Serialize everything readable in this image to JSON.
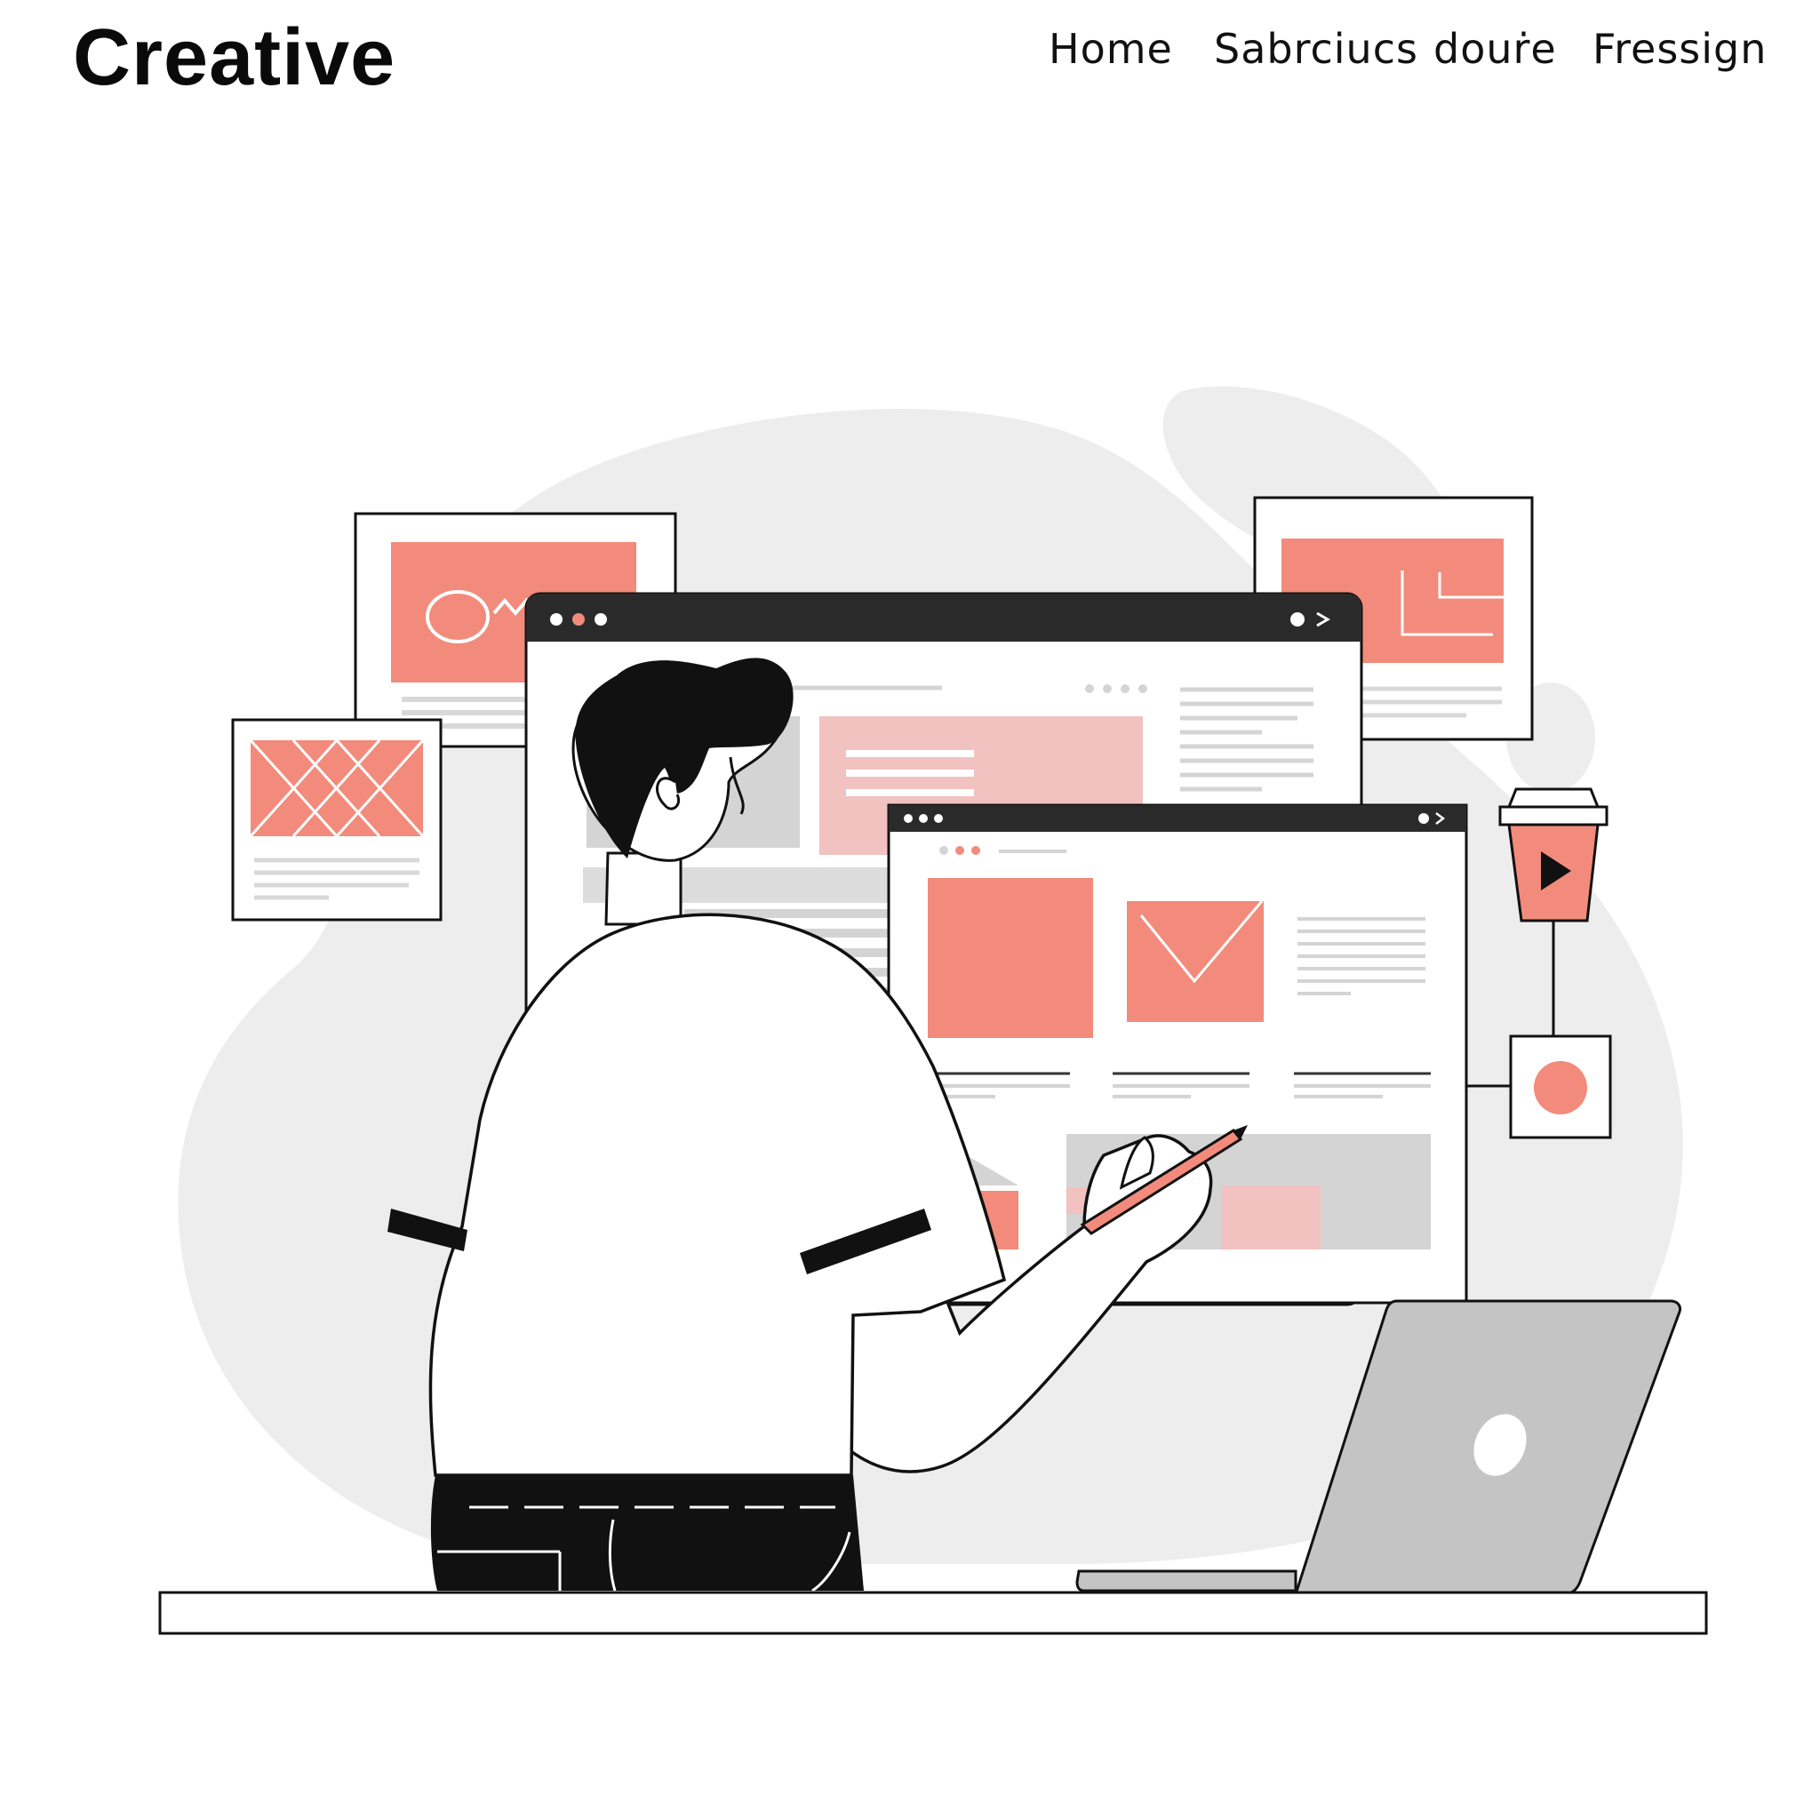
{
  "header": {
    "brand": "Creative",
    "nav": [
      "Home",
      "Sabrciucs",
      "douṙe",
      "Fressign"
    ]
  },
  "colors": {
    "accent": "#f28b7c",
    "accent_light": "#f1c2c0",
    "blob": "#ededee",
    "grey": "#d4d4d4",
    "ink": "#0b0b0b",
    "laptop": "#c4c4c4"
  },
  "illustration": {
    "icons": [
      "x-image-icon",
      "chevron-down-icon",
      "play-icon",
      "record-dot-icon",
      "laptop-logo-icon"
    ]
  }
}
